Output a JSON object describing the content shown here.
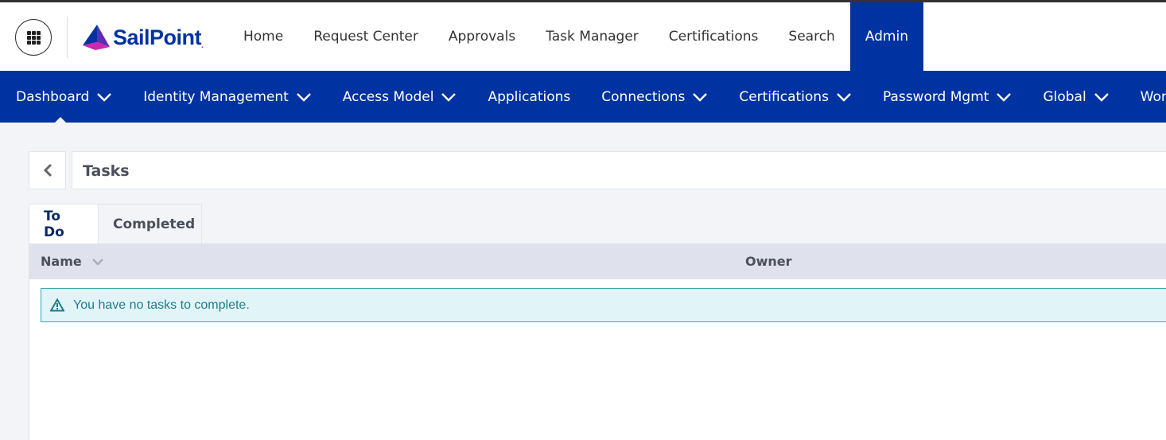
{
  "header": {
    "app_menu_icon": "grid-icon",
    "logo_text": "SailPoint",
    "logo_suffix": ".",
    "nav": [
      {
        "label": "Home",
        "active": false
      },
      {
        "label": "Request Center",
        "active": false
      },
      {
        "label": "Approvals",
        "active": false
      },
      {
        "label": "Task Manager",
        "active": false
      },
      {
        "label": "Certifications",
        "active": false
      },
      {
        "label": "Search",
        "active": false
      },
      {
        "label": "Admin",
        "active": true
      }
    ]
  },
  "subnav": {
    "items": [
      {
        "label": "Dashboard",
        "has_menu": true
      },
      {
        "label": "Identity Management",
        "has_menu": true
      },
      {
        "label": "Access Model",
        "has_menu": true
      },
      {
        "label": "Applications",
        "has_menu": false
      },
      {
        "label": "Connections",
        "has_menu": true
      },
      {
        "label": "Certifications",
        "has_menu": true
      },
      {
        "label": "Password Mgmt",
        "has_menu": true
      },
      {
        "label": "Global",
        "has_menu": true
      },
      {
        "label": "Workflows",
        "has_menu": false
      }
    ]
  },
  "page": {
    "back_icon": "chevron-left-icon",
    "title": "Tasks"
  },
  "tabs": [
    {
      "label": "To Do",
      "active": true
    },
    {
      "label": "Completed",
      "active": false
    }
  ],
  "table": {
    "columns": [
      {
        "label": "Name",
        "sortable": true
      },
      {
        "label": "Owner",
        "sortable": false
      }
    ],
    "empty_message": "You have no tasks to complete.",
    "empty_icon": "warning-triangle-icon"
  },
  "colors": {
    "brand_blue": "#0033a1",
    "brand_magenta": "#cc27b0",
    "alert_bg": "#e1f5f8",
    "alert_border": "#3aa6b1",
    "alert_text": "#1f7c88"
  }
}
